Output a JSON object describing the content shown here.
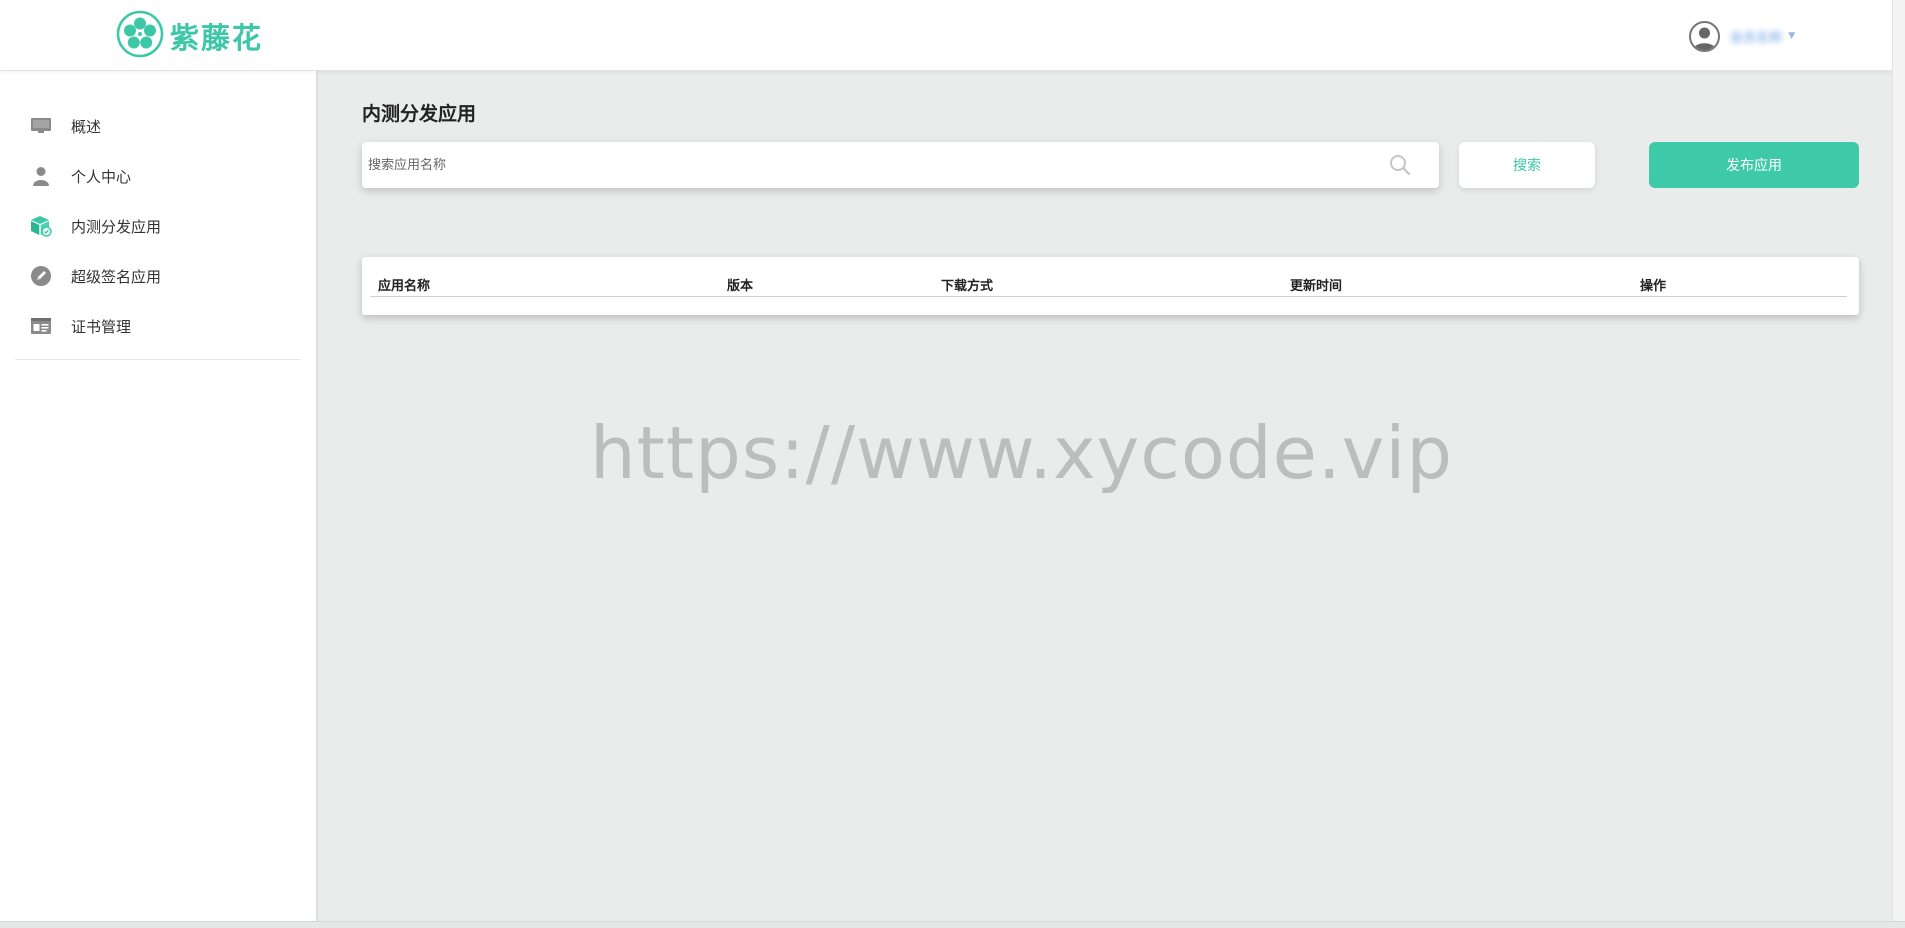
{
  "brand": {
    "name": "紫藤花",
    "accent_color": "#3cc8a7",
    "logo_icon": "flower-logo-icon"
  },
  "header": {
    "user": {
      "avatar_icon": "user-avatar-icon",
      "name": "会员名称",
      "dropdown_icon": "caret-down-icon"
    }
  },
  "sidebar": {
    "items": [
      {
        "label": "概述",
        "icon": "monitor-icon",
        "active": false
      },
      {
        "label": "个人中心",
        "icon": "person-icon",
        "active": false
      },
      {
        "label": "内测分发应用",
        "icon": "package-box-icon",
        "active": true
      },
      {
        "label": "超级签名应用",
        "icon": "pen-icon",
        "active": false
      },
      {
        "label": "证书管理",
        "icon": "id-card-icon",
        "active": false
      }
    ]
  },
  "main": {
    "title": "内测分发应用",
    "search": {
      "placeholder": "搜索应用名称",
      "value": "",
      "button_label": "搜索"
    },
    "publish_button_label": "发布应用",
    "table": {
      "columns": [
        "应用名称",
        "版本",
        "下载方式",
        "更新时间",
        "操作"
      ],
      "rows": []
    },
    "watermark": "https://www.xycode.vip"
  }
}
